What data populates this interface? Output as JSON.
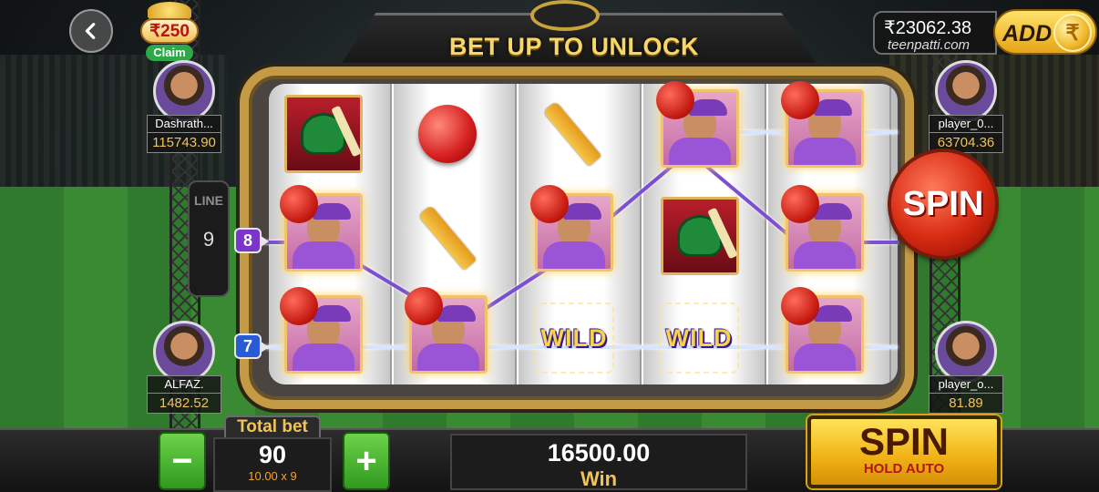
{
  "header": {
    "title": "BET UP TO UNLOCK",
    "back_icon": "chevron-left-icon"
  },
  "claim": {
    "amount": "₹250",
    "label": "Claim"
  },
  "wallet": {
    "balance": "₹23062.38",
    "site": "teenpatti.com",
    "add_label": "ADD",
    "coin_symbol": "₹"
  },
  "players": {
    "left_top": {
      "name": "Dashrath...",
      "balance": "115743.90"
    },
    "left_bottom": {
      "name": "ALFAZ.",
      "balance": "1482.52"
    },
    "right_top": {
      "name": "player_0...",
      "balance": "63704.36"
    },
    "right_bottom": {
      "name": "player_o...",
      "balance": "81.89"
    }
  },
  "line_panel": {
    "label": "LINE",
    "value": "9"
  },
  "line_badges": [
    "8",
    "7"
  ],
  "reels": {
    "grid": [
      [
        "green-batsman",
        "ball",
        "bat",
        "purple-player",
        "purple-player"
      ],
      [
        "purple-player",
        "bat",
        "purple-player",
        "green-batsman",
        "purple-player"
      ],
      [
        "purple-player",
        "purple-player",
        "wild",
        "wild",
        "purple-player"
      ]
    ],
    "wild_label": "WILD"
  },
  "spin_round_label": "SPIN",
  "bottom": {
    "total_bet_label": "Total bet",
    "total_bet_value": "90",
    "bet_formula": "10.00 x 9",
    "minus_label": "−",
    "plus_label": "+",
    "win_value": "16500.00",
    "win_label": "Win",
    "spin_label": "SPIN",
    "spin_sub": "HOLD AUTO"
  },
  "colors": {
    "gold": "#f1c35a",
    "frame": "#c49a45",
    "spin_red": "#d62a12",
    "button_green": "#2f9a1f",
    "payline_purple": "#7b4fd1"
  }
}
